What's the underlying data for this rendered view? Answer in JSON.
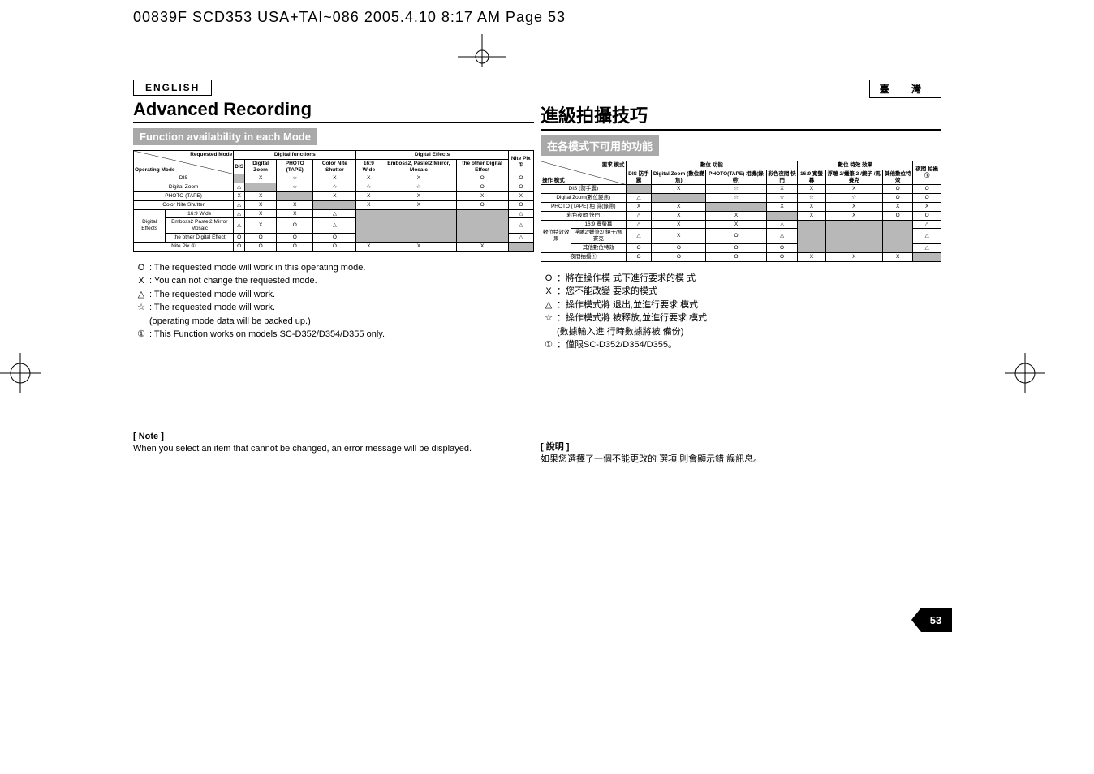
{
  "header_bar": "00839F SCD353 USA+TAI~086  2005.4.10  8:17 AM  Page 53",
  "left": {
    "lang": "ENGLISH",
    "title": "Advanced Recording",
    "subtitle": "Function availability in each Mode",
    "legend": [
      {
        "sym": "O",
        "txt": ": The requested mode will work in this operating mode."
      },
      {
        "sym": "X",
        "txt": ": You can not change the requested mode."
      },
      {
        "sym": "△",
        "txt": ": The requested mode will work."
      },
      {
        "sym": "☆",
        "txt": ": The requested mode will work."
      },
      {
        "sym": "",
        "txt": "  (operating mode data will be backed up.)"
      },
      {
        "sym": "①",
        "txt": ": This Function works on models SC-D352/D354/D355 only."
      }
    ],
    "note_head": "[ Note ]",
    "note_body": "When you select an item that cannot be changed, an error message will be displayed."
  },
  "right": {
    "lang": "臺 灣",
    "title": "進級拍攝技巧",
    "subtitle": "在各模式下可用的功能",
    "legend": [
      {
        "sym": "O",
        "txt": "：將在操作模 式下進行要求的模 式"
      },
      {
        "sym": "X",
        "txt": "：您不能改變 要求的模式"
      },
      {
        "sym": "△",
        "txt": "：操作模式將 退出,並進行要求 模式"
      },
      {
        "sym": "☆",
        "txt": "：操作模式將 被釋放,並進行要求 模式"
      },
      {
        "sym": "",
        "txt": "   (數據輸入進 行時數據將被 備份)"
      },
      {
        "sym": "①",
        "txt": "：僅限SC-D352/D354/D355。"
      }
    ],
    "note_head": "[ 說明 ]",
    "note_body": "如果您選擇了一個不能更改的 選項,則會顯示錯 誤訊息。"
  },
  "table_en": {
    "hdr_req": "Requested Mode",
    "hdr_op": "Operating Mode",
    "grp_digfunc": "Digital functions",
    "grp_digeff": "Digital Effects",
    "col_nitepix": "Nite Pix ①",
    "cols": [
      "DIS",
      "Digital Zoom",
      "PHOTO (TAPE)",
      "Color Nite Shutter",
      "16:9 Wide",
      "Emboss2, Pastel2 Mirror, Mosaic",
      "the other Digital Effect"
    ],
    "row_dis": "DIS",
    "row_dz": "Digital Zoom",
    "row_photo": "PHOTO (TAPE)",
    "row_cns": "Color Nite Shutter",
    "row_de": "Digital Effects",
    "row_169": "16:9 Wide",
    "row_empm": "Emboss2 Pastel2 Mirror Mosaic",
    "row_other": "the other Digital Effect",
    "row_nite": "Nite Pix ①"
  },
  "table_zh": {
    "hdr_req": "要求 模式",
    "hdr_op": "操作 模式",
    "grp_digfunc": "數位 功能",
    "grp_digeff": "數位 特效 效果",
    "col_nitepix": "夜間 拍攝 ①",
    "cols": [
      "DIS 防手震",
      "Digital Zoom (數位變焦)",
      "PHOTO(TAPE) 相機(錄帶)",
      "彩色夜間 快門",
      "16:9 寬螢幕",
      "浮雕 2/蠟筆 2 /鏡子 /馬賽克",
      "其他數位特效"
    ],
    "row_dis": "DIS (防手震)",
    "row_dz": "Digital Zoom(數位變焦)",
    "row_photo": "PHOTO (TAPE) 相 眞(錄帶)",
    "row_cns": "彩色夜間 快門",
    "row_de": "數位特效效果",
    "row_169": "16:9 寬螢幕",
    "row_empm": "浮雕2/蠟筆2/ 鏡子/馬賽克",
    "row_other": "其他數位特效",
    "row_nite": "夜間拍攝①"
  },
  "chart_data": {
    "type": "table",
    "columns": [
      "DIS",
      "Digital Zoom",
      "PHOTO (TAPE)",
      "Color Nite Shutter",
      "16:9 Wide",
      "Emboss2/Pastel2/Mirror/Mosaic",
      "other Digital Effect",
      "Nite Pix"
    ],
    "rows": [
      {
        "name": "DIS",
        "cells": [
          "gray",
          "X",
          "☆",
          "X",
          "X",
          "X",
          "O",
          "O"
        ]
      },
      {
        "name": "Digital Zoom",
        "cells": [
          "△",
          "gray",
          "☆",
          "☆",
          "☆",
          "☆",
          "O",
          "O"
        ]
      },
      {
        "name": "PHOTO (TAPE)",
        "cells": [
          "X",
          "X",
          "gray",
          "X",
          "X",
          "X",
          "X",
          "X"
        ]
      },
      {
        "name": "Color Nite Shutter",
        "cells": [
          "△",
          "X",
          "X",
          "gray",
          "X",
          "X",
          "O",
          "O"
        ]
      },
      {
        "name": "16:9 Wide",
        "cells": [
          "△",
          "X",
          "X",
          "△",
          "gray",
          "gray",
          "gray",
          "△"
        ]
      },
      {
        "name": "Emboss2/Pastel2/Mirror/Mosaic",
        "cells": [
          "△",
          "X",
          "O",
          "△",
          "gray",
          "gray",
          "gray",
          "△"
        ]
      },
      {
        "name": "other Digital Effect",
        "cells": [
          "O",
          "O",
          "O",
          "O",
          "gray",
          "gray",
          "gray",
          "△"
        ]
      },
      {
        "name": "Nite Pix",
        "cells": [
          "O",
          "O",
          "O",
          "O",
          "X",
          "X",
          "X",
          "gray"
        ]
      }
    ]
  },
  "page_number": "53"
}
